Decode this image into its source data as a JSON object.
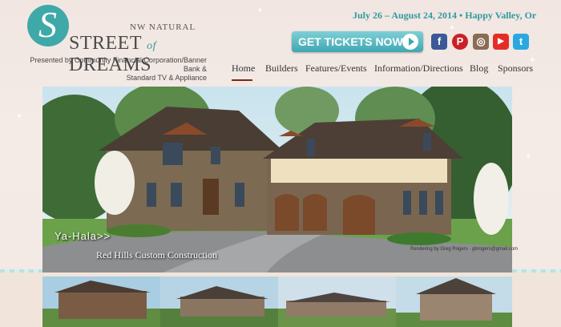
{
  "logo": {
    "letter": "S",
    "line1": "NW NATURAL",
    "street": "STREET",
    "of": "of",
    "dreams": "DREAMS"
  },
  "presented_by": {
    "line1": "Presented by Community Financial Corporation/Banner Bank &",
    "line2": "Standard TV & Appliance"
  },
  "event_dates": "July 26 – August 24, 2014 • Happy Valley, Or",
  "tickets_button": "GET TICKETS NOW",
  "social": [
    {
      "icon": "facebook-icon",
      "label": "f",
      "color": "#3b5998"
    },
    {
      "icon": "pinterest-icon",
      "label": "P",
      "color": "#cb2027"
    },
    {
      "icon": "instagram-icon",
      "label": "◎",
      "color": "#8a6b54"
    },
    {
      "icon": "youtube-icon",
      "label": "▶",
      "color": "#e52d27"
    },
    {
      "icon": "twitter-icon",
      "label": "t",
      "color": "#2aa9e0"
    }
  ],
  "nav": [
    "Home",
    "Builders",
    "Features/Events",
    "Information/Directions",
    "Blog",
    "Sponsors"
  ],
  "hero": {
    "home_name": "Ya-Hala>>",
    "builder": "Red Hills Custom Construction",
    "credit": "Rendering by Greg Rogers · gbrogers@gmail.com"
  },
  "colors": {
    "teal": "#3fa9a9",
    "nav_active": "#7a2a1a"
  }
}
